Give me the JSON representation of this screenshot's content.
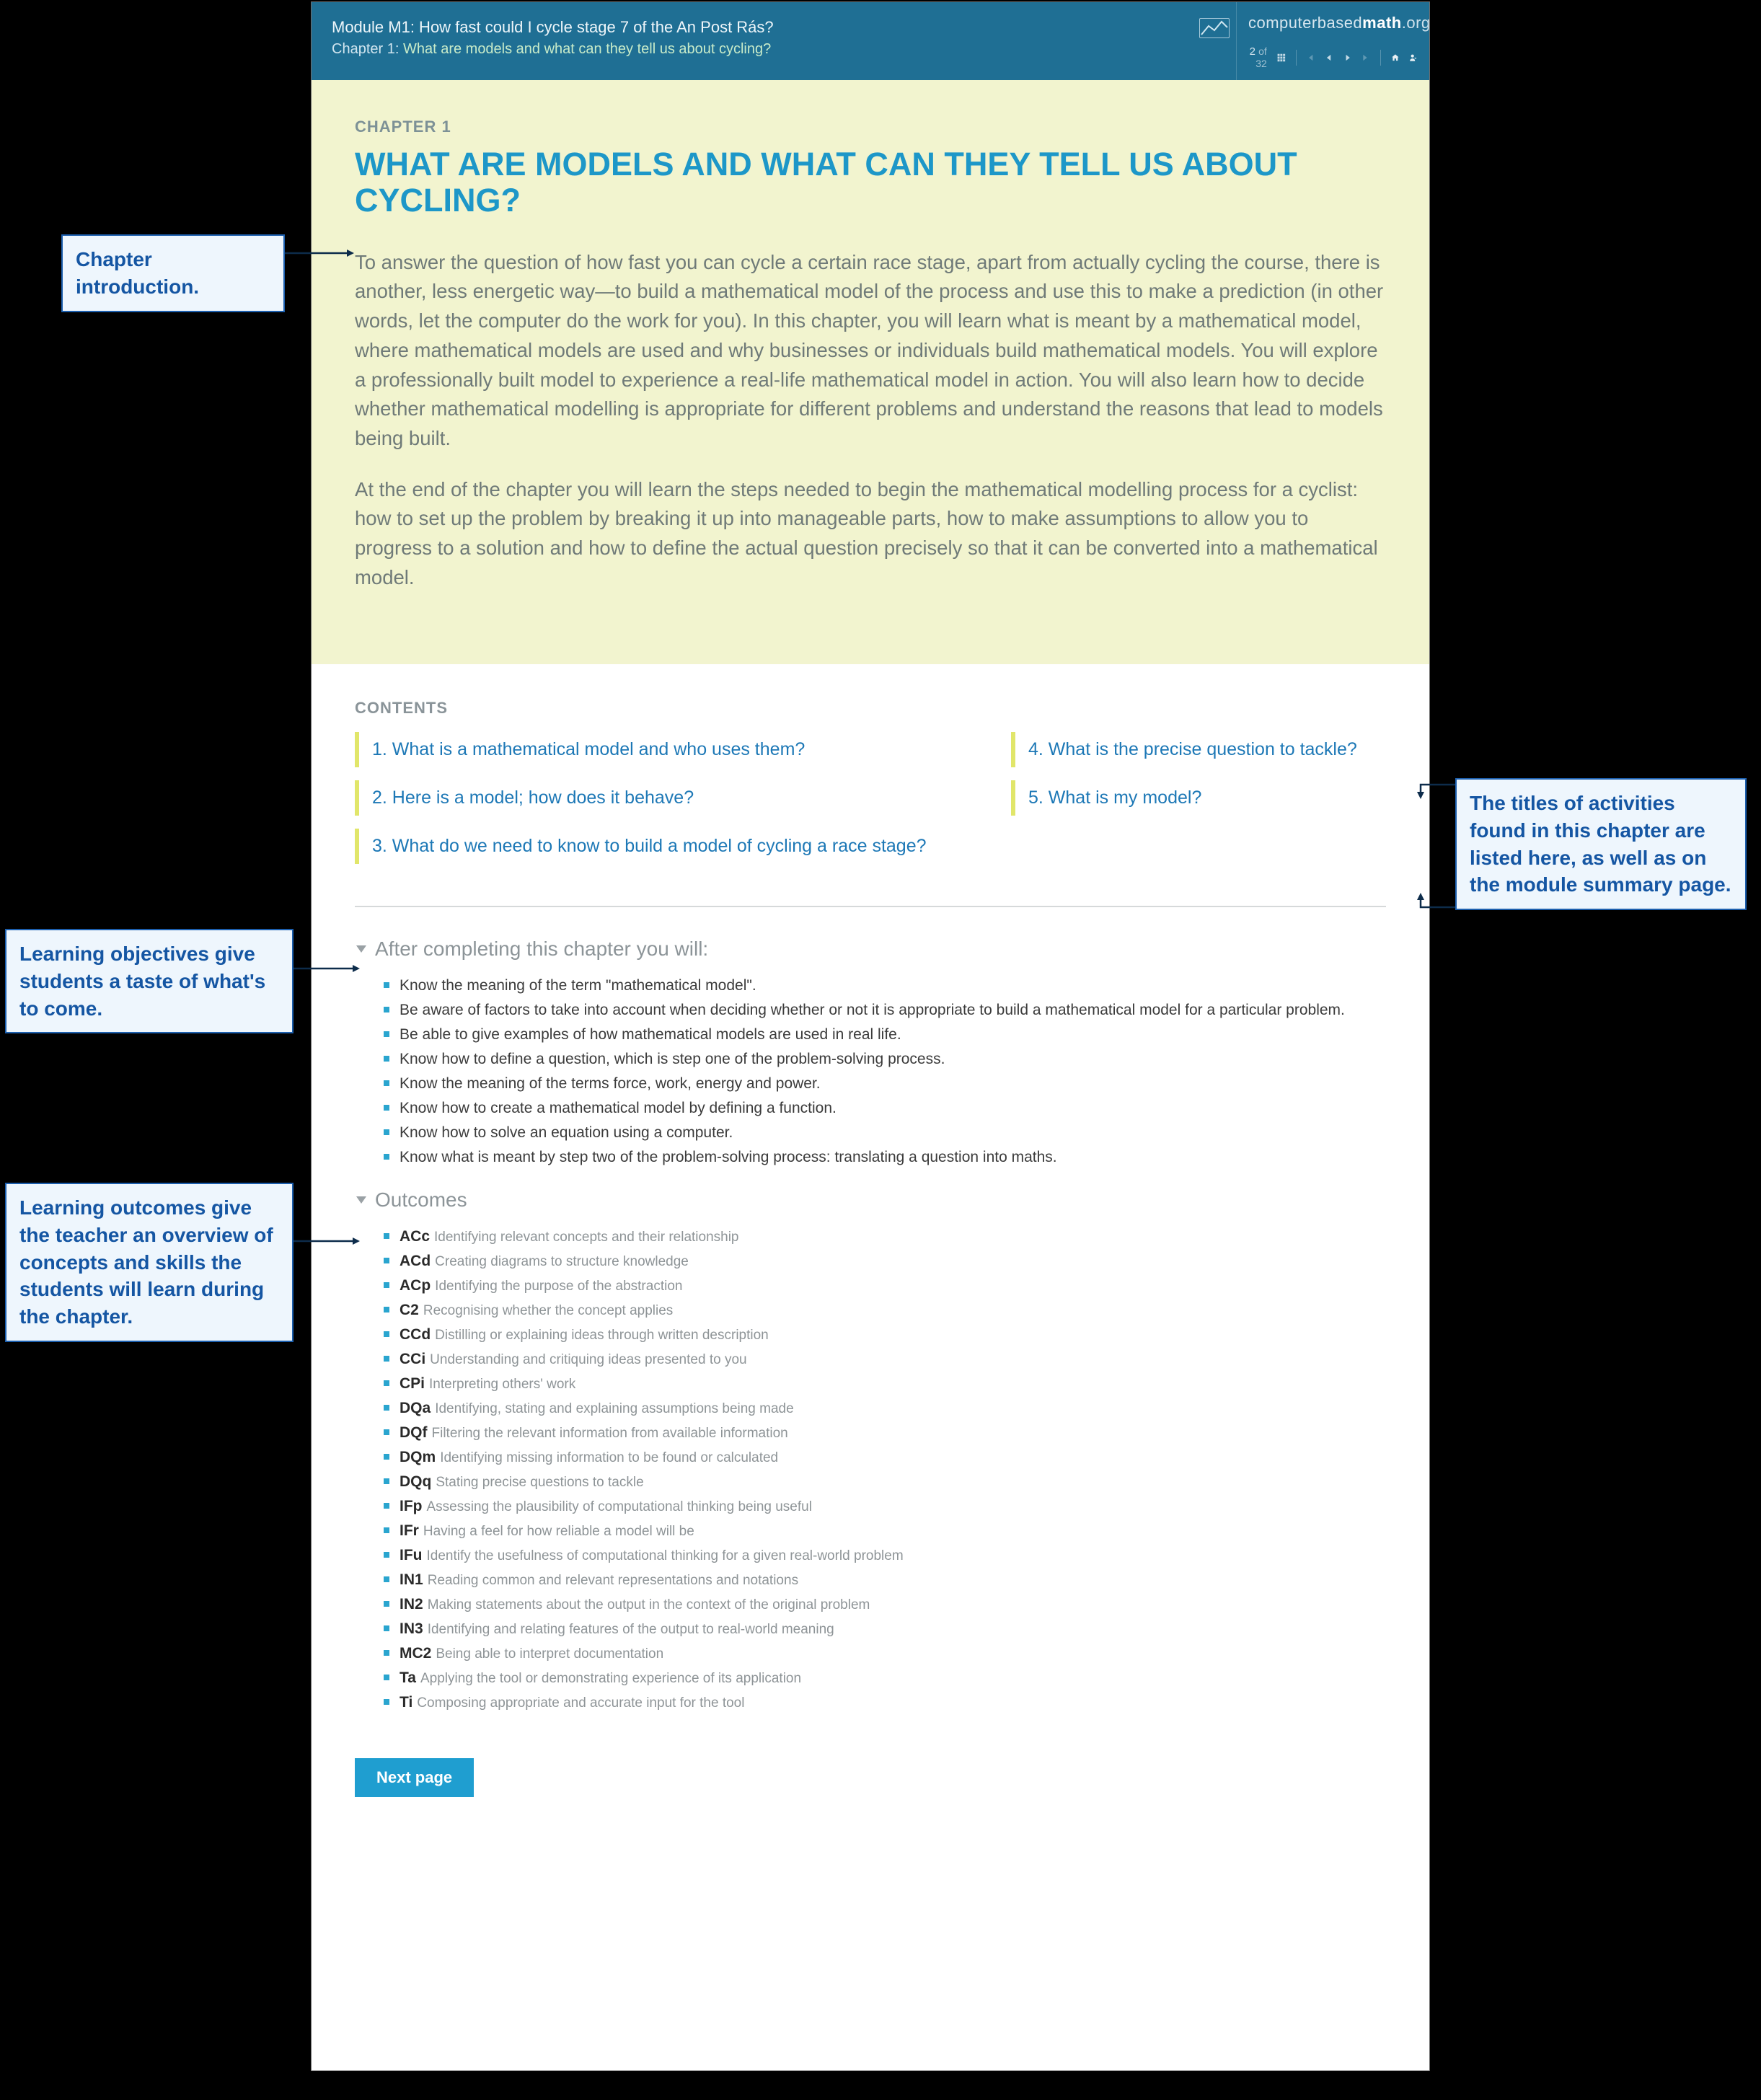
{
  "header": {
    "module_line": "Module M1: How fast could I cycle stage 7 of the An Post Rás?",
    "chapter_prefix": "Chapter 1:",
    "chapter_line_title": "What are models and what can they tell us about cycling?",
    "brand_thin": "computer",
    "brand_bold": "based",
    "brand_bold2": "math",
    "brand_domain": ".org",
    "page_current": "2",
    "page_of": "of",
    "page_total": "32"
  },
  "intro": {
    "eyebrow": "CHAPTER 1",
    "title": "WHAT ARE MODELS AND WHAT CAN THEY TELL US ABOUT CYCLING?",
    "para1": "To answer the question of how fast you can cycle a certain race stage, apart from actually cycling the course, there is another, less energetic way—to build a mathematical model of the process and use this to make a prediction (in other words, let the computer do the work for you). In this chapter, you will learn what is meant by a mathematical model, where mathematical models are used and why businesses or individuals build mathematical models. You will explore a professionally built model to experience a real-life mathematical model in action. You will also learn how to decide whether mathematical modelling is appropriate for different problems and understand the reasons that lead to models being built.",
    "para2": "At the end of the chapter you will learn the steps needed to begin the mathematical modelling process for a cyclist: how to set up the problem by breaking it up into manageable parts, how to make assumptions to allow you to progress to a solution and how to define the actual question precisely so that it can be converted into a mathematical model."
  },
  "contents": {
    "label": "CONTENTS",
    "col1": [
      "1.  What is a mathematical model and who uses them?",
      "2.  Here is a model; how does it behave?",
      "3.  What do we need to know to build a model of cycling a race stage?"
    ],
    "col2": [
      "4.  What is the precise question to tackle?",
      "5.  What is my model?"
    ]
  },
  "objectives": {
    "heading": "After completing this chapter you will:",
    "items": [
      "Know the meaning of the term \"mathematical model\".",
      "Be aware of factors to take into account when deciding whether or not it is appropriate to build a mathematical model for a particular problem.",
      "Be able to give examples of how mathematical models are used in real life.",
      "Know how to define a question, which is step one of the problem-solving process.",
      "Know the meaning of the terms force, work, energy and power.",
      "Know how to create a mathematical model by defining a function.",
      "Know how to solve an equation using a computer.",
      "Know what is meant by step two of the problem-solving process: translating a question into maths."
    ]
  },
  "outcomes": {
    "heading": "Outcomes",
    "items": [
      {
        "code": "ACc",
        "desc": "Identifying relevant concepts and their relationship"
      },
      {
        "code": "ACd",
        "desc": "Creating diagrams to structure knowledge"
      },
      {
        "code": "ACp",
        "desc": "Identifying the purpose of the abstraction"
      },
      {
        "code": "C2",
        "desc": "Recognising whether the concept applies"
      },
      {
        "code": "CCd",
        "desc": "Distilling or explaining ideas through written description"
      },
      {
        "code": "CCi",
        "desc": "Understanding and critiquing ideas presented to you"
      },
      {
        "code": "CPi",
        "desc": "Interpreting others' work"
      },
      {
        "code": "DQa",
        "desc": "Identifying, stating and explaining assumptions being made"
      },
      {
        "code": "DQf",
        "desc": "Filtering the relevant information from available information"
      },
      {
        "code": "DQm",
        "desc": "Identifying missing information to be found or calculated"
      },
      {
        "code": "DQq",
        "desc": "Stating precise questions to tackle"
      },
      {
        "code": "IFp",
        "desc": "Assessing the plausibility of computational thinking being useful"
      },
      {
        "code": "IFr",
        "desc": "Having a feel for how reliable a model will be"
      },
      {
        "code": "IFu",
        "desc": "Identify the usefulness of computational thinking for a given real-world problem"
      },
      {
        "code": "IN1",
        "desc": "Reading common and relevant representations and notations"
      },
      {
        "code": "IN2",
        "desc": "Making statements about the output in the context of the original problem"
      },
      {
        "code": "IN3",
        "desc": "Identifying and relating features of the output to real-world meaning"
      },
      {
        "code": "MC2",
        "desc": "Being able to interpret documentation"
      },
      {
        "code": "Ta",
        "desc": "Applying the tool or demonstrating experience of its application"
      },
      {
        "code": "Ti",
        "desc": "Composing appropriate and accurate input for the tool"
      }
    ]
  },
  "next_button": "Next page",
  "callouts": {
    "intro": "Chapter introduction.",
    "contents": "The titles of activities found in this chapter are listed here, as well as on the module summary page.",
    "objectives": "Learning objectives give students a taste of what's to come.",
    "outcomes": "Learning outcomes give the teacher an overview of concepts and skills the students will learn during the chapter."
  }
}
